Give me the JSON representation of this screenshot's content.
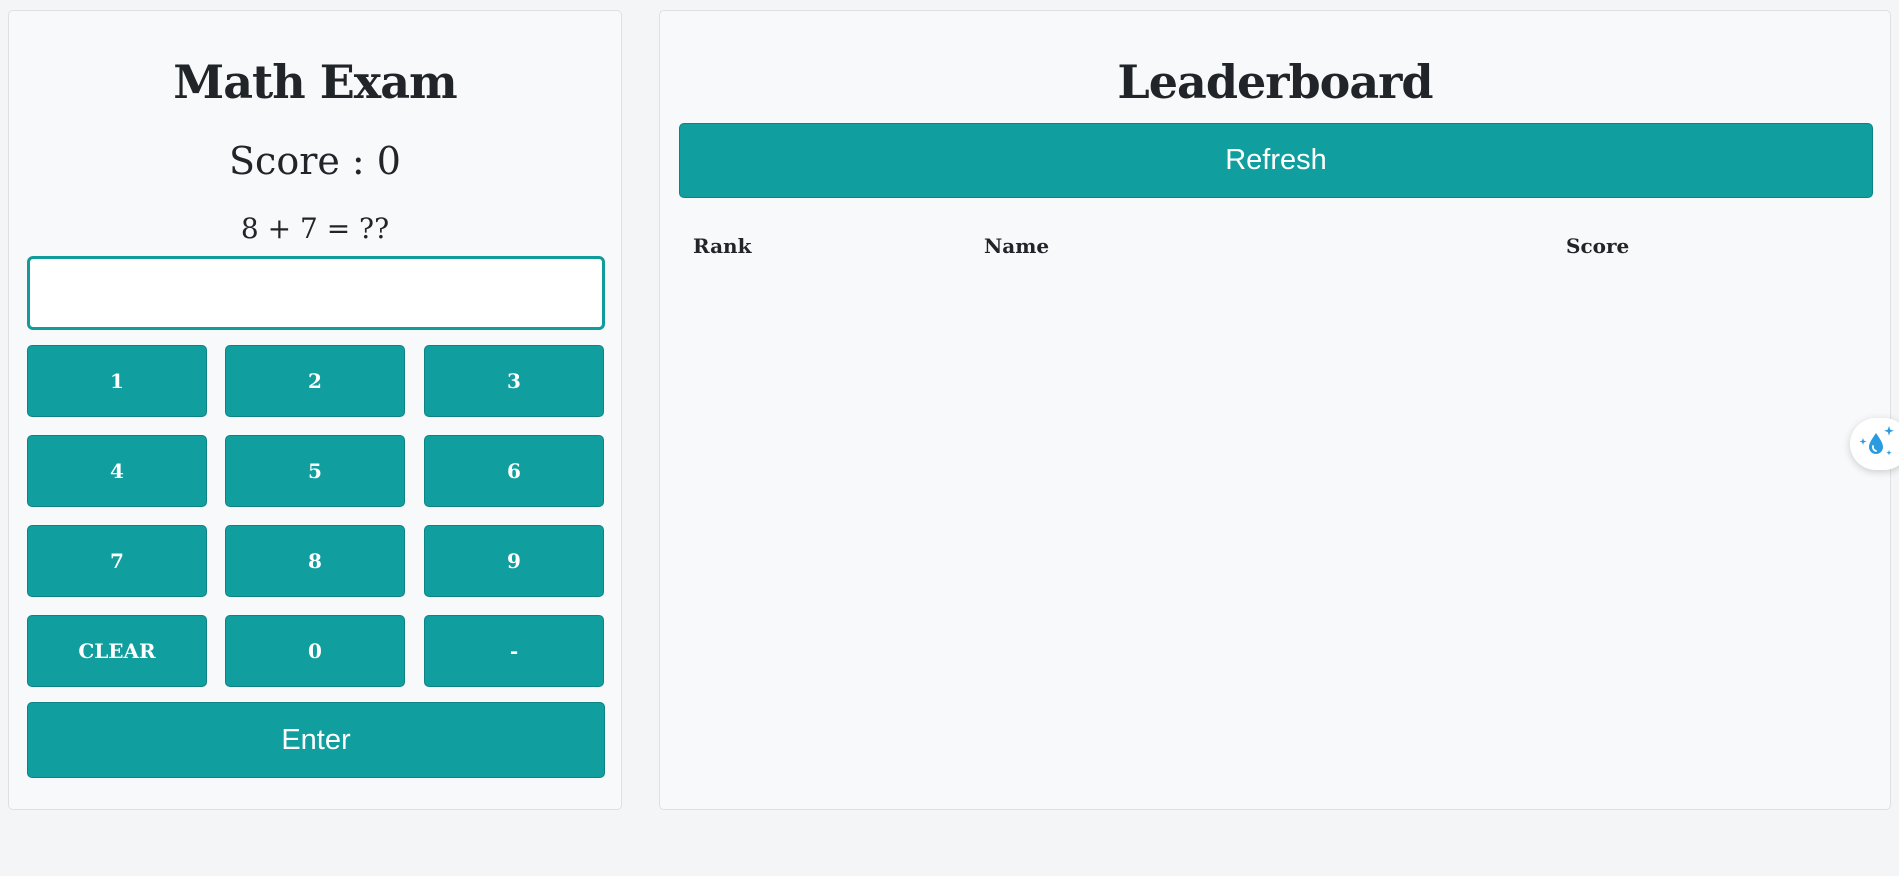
{
  "exam": {
    "title": "Math Exam",
    "score_label": "Score : 0",
    "question": "8 + 7 = ??",
    "answer_value": "",
    "keys": [
      "1",
      "2",
      "3",
      "4",
      "5",
      "6",
      "7",
      "8",
      "9",
      "CLEAR",
      "0",
      "-"
    ],
    "enter_label": "Enter"
  },
  "leaderboard": {
    "title": "Leaderboard",
    "refresh_label": "Refresh",
    "columns": [
      "Rank",
      "Name",
      "Score"
    ],
    "rows": []
  },
  "colors": {
    "accent": "#119e9f",
    "accent_border": "#0c8485",
    "panel_bg": "#f8f9fa",
    "page_bg": "#f4f5f6",
    "text": "#212529",
    "fab_icon": "#2a9be0"
  },
  "icons": {
    "fab": "sparkle-drop-icon"
  }
}
